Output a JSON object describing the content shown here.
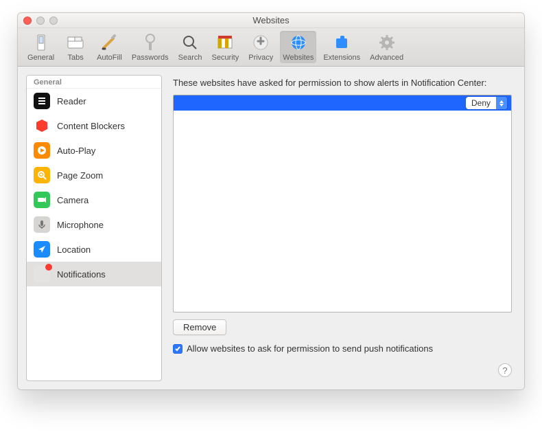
{
  "window": {
    "title": "Websites"
  },
  "toolbar": [
    {
      "id": "general",
      "label": "General"
    },
    {
      "id": "tabs",
      "label": "Tabs"
    },
    {
      "id": "autofill",
      "label": "AutoFill"
    },
    {
      "id": "passwords",
      "label": "Passwords"
    },
    {
      "id": "search",
      "label": "Search"
    },
    {
      "id": "security",
      "label": "Security"
    },
    {
      "id": "privacy",
      "label": "Privacy"
    },
    {
      "id": "websites",
      "label": "Websites",
      "selected": true
    },
    {
      "id": "extensions",
      "label": "Extensions"
    },
    {
      "id": "advanced",
      "label": "Advanced"
    }
  ],
  "sidebar": {
    "header": "General",
    "items": [
      {
        "id": "reader",
        "label": "Reader"
      },
      {
        "id": "content-blockers",
        "label": "Content Blockers"
      },
      {
        "id": "auto-play",
        "label": "Auto-Play"
      },
      {
        "id": "page-zoom",
        "label": "Page Zoom"
      },
      {
        "id": "camera",
        "label": "Camera"
      },
      {
        "id": "microphone",
        "label": "Microphone"
      },
      {
        "id": "location",
        "label": "Location"
      },
      {
        "id": "notifications",
        "label": "Notifications",
        "selected": true,
        "badge": true
      }
    ]
  },
  "main": {
    "instruction": "These websites have asked for permission to show alerts in Notification Center:",
    "rows": [
      {
        "site": "",
        "permission": "Deny",
        "selected": true
      }
    ],
    "remove_label": "Remove",
    "checkbox_label": "Allow websites to ask for permission to send push notifications",
    "checkbox_checked": true
  }
}
